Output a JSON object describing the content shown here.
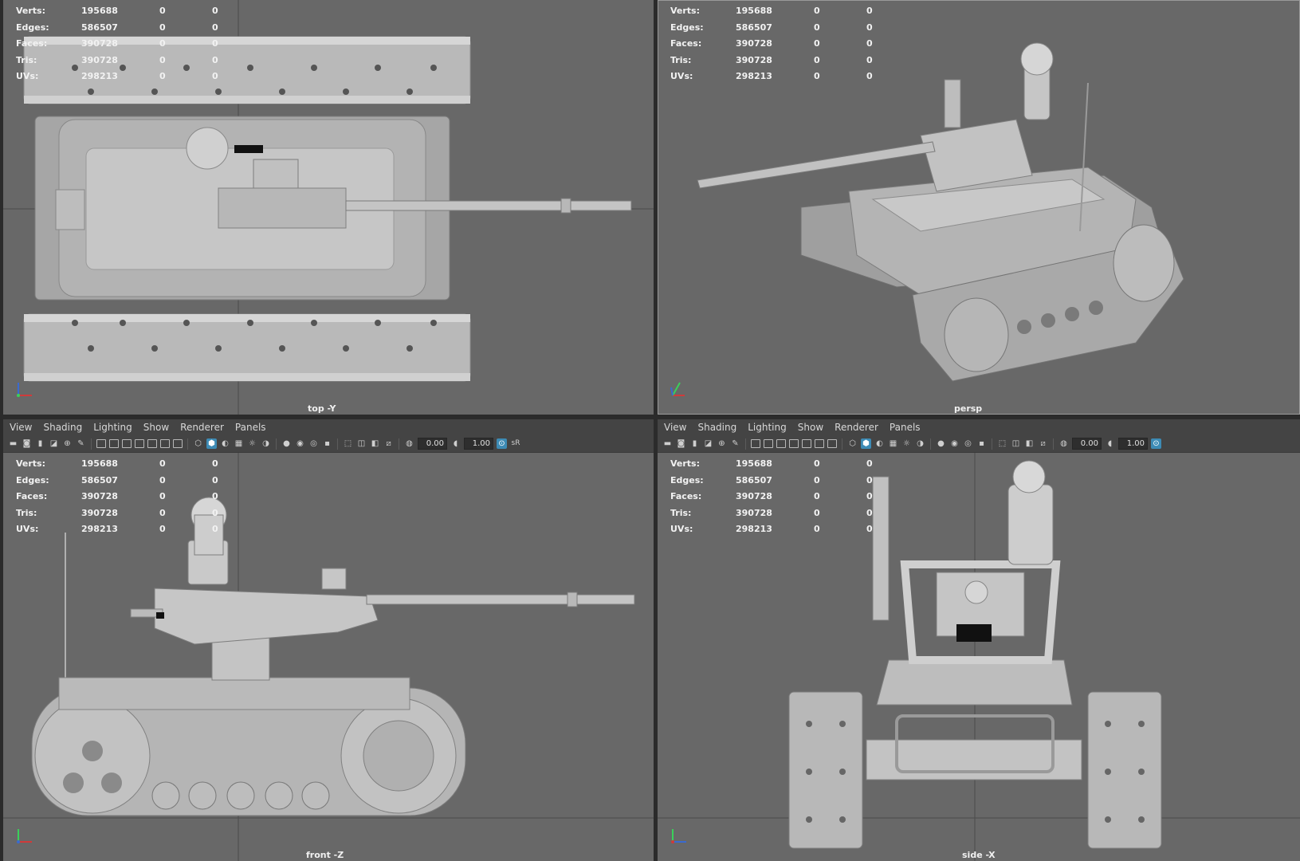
{
  "menu": [
    "View",
    "Shading",
    "Lighting",
    "Show",
    "Renderer",
    "Panels"
  ],
  "stats": [
    {
      "label": "Verts:",
      "v1": "195688",
      "v2": "0",
      "v3": "0"
    },
    {
      "label": "Edges:",
      "v1": "586507",
      "v2": "0",
      "v3": "0"
    },
    {
      "label": "Faces:",
      "v1": "390728",
      "v2": "0",
      "v3": "0"
    },
    {
      "label": "Tris:",
      "v1": "390728",
      "v2": "0",
      "v3": "0"
    },
    {
      "label": "UVs:",
      "v1": "298213",
      "v2": "0",
      "v3": "0"
    }
  ],
  "panes": {
    "top": {
      "camera": "top -Y"
    },
    "persp": {
      "camera": "persp"
    },
    "front": {
      "camera": "front -Z"
    },
    "side": {
      "camera": "side -X"
    }
  },
  "toolbar": {
    "exposure": "0.00",
    "gamma": "1.00",
    "colorspace_badge": "sR"
  },
  "colors": {
    "viewport_bg": "#686868",
    "chrome_bg": "#444444",
    "active_icon": "#3d8bb5",
    "axis_x": "#d03a3a",
    "axis_y": "#3ad05a",
    "axis_z": "#3a6ad0"
  }
}
